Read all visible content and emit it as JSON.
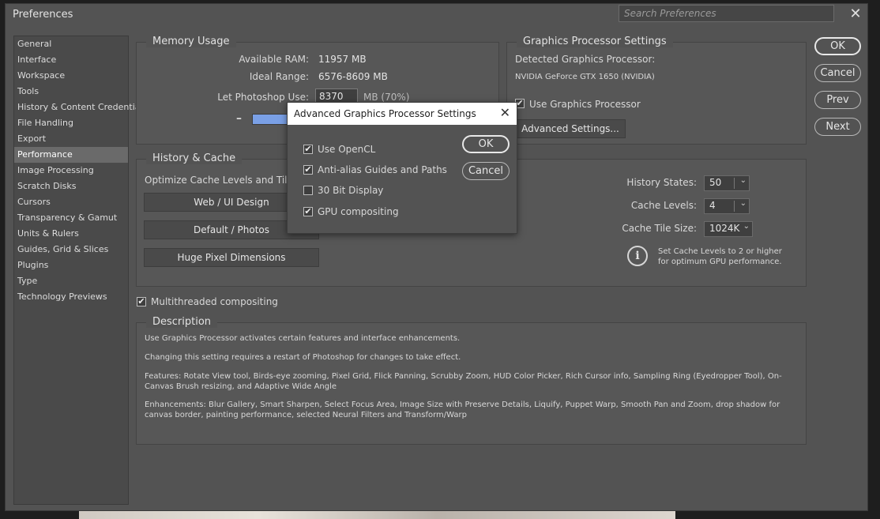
{
  "window": {
    "title": "Preferences",
    "search_placeholder": "Search Preferences",
    "close_glyph": "✕"
  },
  "sidebar": {
    "items": [
      {
        "label": "General"
      },
      {
        "label": "Interface"
      },
      {
        "label": "Workspace"
      },
      {
        "label": "Tools"
      },
      {
        "label": "History & Content Credentials"
      },
      {
        "label": "File Handling"
      },
      {
        "label": "Export"
      },
      {
        "label": "Performance",
        "active": true
      },
      {
        "label": "Image Processing"
      },
      {
        "label": "Scratch Disks"
      },
      {
        "label": "Cursors"
      },
      {
        "label": "Transparency & Gamut"
      },
      {
        "label": "Units & Rulers"
      },
      {
        "label": "Guides, Grid & Slices"
      },
      {
        "label": "Plugins"
      },
      {
        "label": "Type"
      },
      {
        "label": "Technology Previews"
      }
    ]
  },
  "buttons": {
    "ok": "OK",
    "cancel": "Cancel",
    "prev": "Prev",
    "next": "Next"
  },
  "memory": {
    "title": "Memory Usage",
    "available_label": "Available RAM:",
    "available_value": "11957 MB",
    "ideal_label": "Ideal Range:",
    "ideal_value": "6576-8609 MB",
    "let_label": "Let Photoshop Use:",
    "let_value": "8370",
    "let_unit": "MB (70%)",
    "minus": "–",
    "percent": 0.7
  },
  "gpu": {
    "title": "Graphics Processor Settings",
    "detected_label": "Detected Graphics Processor:",
    "detected_value": "NVIDIA GeForce GTX 1650 (NVIDIA)",
    "use_gpu_label": "Use Graphics Processor",
    "use_gpu_checked": true,
    "advanced_btn": "Advanced Settings..."
  },
  "history": {
    "title": "History & Cache",
    "optimize_label": "Optimize Cache Levels and Tile S",
    "btn_web": "Web / UI Design",
    "btn_default": "Default / Photos",
    "btn_huge": "Huge Pixel Dimensions",
    "history_states_label": "History States:",
    "history_states_value": "50",
    "cache_levels_label": "Cache Levels:",
    "cache_levels_value": "4",
    "tile_size_label": "Cache Tile Size:",
    "tile_size_value": "1024K",
    "info_text": "Set Cache Levels to 2 or higher for optimum GPU performance."
  },
  "multithreaded": {
    "label": "Multithreaded compositing",
    "checked": true
  },
  "description": {
    "title": "Description",
    "p1": "Use Graphics Processor activates certain features and interface enhancements.",
    "p2": "Changing this setting requires a restart of Photoshop for changes to take effect.",
    "p3": "Features: Rotate View tool, Birds-eye zooming, Pixel Grid, Flick Panning, Scrubby Zoom, HUD Color Picker, Rich Cursor info, Sampling Ring (Eyedropper Tool), On-Canvas Brush resizing, and Adaptive Wide Angle",
    "p4": "Enhancements: Blur Gallery, Smart Sharpen, Select Focus Area, Image Size with Preserve Details, Liquify, Puppet Warp, Smooth Pan and Zoom, drop shadow for canvas border, painting performance, selected Neural Filters and Transform/Warp"
  },
  "dialog": {
    "title": "Advanced Graphics Processor Settings",
    "close_glyph": "✕",
    "ok": "OK",
    "cancel": "Cancel",
    "options": [
      {
        "label": "Use OpenCL",
        "checked": true
      },
      {
        "label": "Anti-alias Guides and Paths",
        "checked": true
      },
      {
        "label": "30 Bit Display",
        "checked": false
      },
      {
        "label": "GPU compositing",
        "checked": true
      }
    ]
  },
  "icons": {
    "check": "✔",
    "chevron": "⌄",
    "info": "i"
  }
}
